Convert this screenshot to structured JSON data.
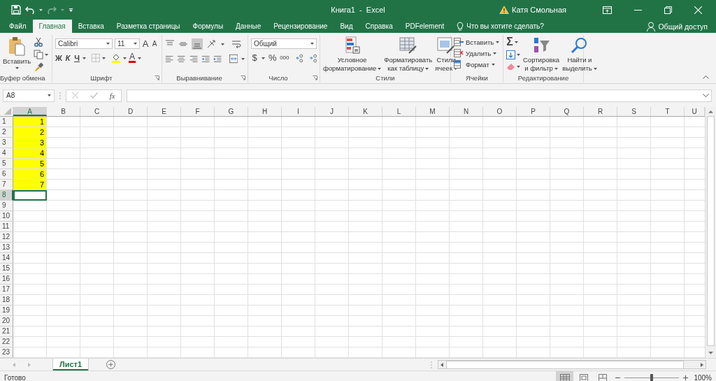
{
  "title_bar": {
    "title": "Книга1  -  Excel",
    "user": "Катя Смольная"
  },
  "tabs": [
    {
      "label": "Файл",
      "selected": false
    },
    {
      "label": "Главная",
      "selected": true
    },
    {
      "label": "Вставка",
      "selected": false
    },
    {
      "label": "Разметка страницы",
      "selected": false
    },
    {
      "label": "Формулы",
      "selected": false
    },
    {
      "label": "Данные",
      "selected": false
    },
    {
      "label": "Рецензирование",
      "selected": false
    },
    {
      "label": "Вид",
      "selected": false
    },
    {
      "label": "Справка",
      "selected": false
    },
    {
      "label": "PDFelement",
      "selected": false
    }
  ],
  "tell_me": {
    "label": "Что вы хотите сделать?"
  },
  "share": {
    "label": "Общий доступ"
  },
  "ribbon": {
    "clipboard": {
      "label": "Буфер обмена",
      "paste": "Вставить"
    },
    "font": {
      "label": "Шрифт",
      "font_name": "Calibri",
      "font_size": "11",
      "grow": "A",
      "shrink": "A",
      "bold": "Ж",
      "italic": "К",
      "underline": "Ч",
      "font_color": "A"
    },
    "alignment": {
      "label": "Выравнивание"
    },
    "number": {
      "label": "Число",
      "format": "Общий",
      "currency": "$",
      "percent": "%",
      "thousands": "000"
    },
    "styles": {
      "label": "Стили",
      "buttons": [
        {
          "lines": [
            "Условное",
            "форматирование"
          ]
        },
        {
          "lines": [
            "Форматировать",
            "как таблицу"
          ]
        },
        {
          "lines": [
            "Стили",
            "ячеек"
          ]
        }
      ]
    },
    "cells": {
      "label": "Ячейки",
      "buttons": [
        "Вставить",
        "Удалить",
        "Формат"
      ]
    },
    "editing": {
      "label": "Редактирование",
      "autosum": "Σ",
      "buttons": [
        {
          "lines": [
            "Сортировка",
            "и фильтр"
          ]
        },
        {
          "lines": [
            "Найти и",
            "выделить"
          ]
        }
      ]
    }
  },
  "formula_bar": {
    "name_box": "A8",
    "function_label": "fx"
  },
  "grid": {
    "columns": [
      {
        "label": "A",
        "selected": true
      },
      {
        "label": "B",
        "selected": false
      },
      {
        "label": "C",
        "selected": false
      },
      {
        "label": "D",
        "selected": false
      },
      {
        "label": "E",
        "selected": false
      },
      {
        "label": "F",
        "selected": false
      },
      {
        "label": "G",
        "selected": false
      },
      {
        "label": "H",
        "selected": false
      },
      {
        "label": "I",
        "selected": false
      },
      {
        "label": "J",
        "selected": false
      },
      {
        "label": "K",
        "selected": false
      },
      {
        "label": "L",
        "selected": false
      },
      {
        "label": "M",
        "selected": false
      },
      {
        "label": "N",
        "selected": false
      },
      {
        "label": "O",
        "selected": false
      },
      {
        "label": "P",
        "selected": false
      },
      {
        "label": "Q",
        "selected": false
      },
      {
        "label": "R",
        "selected": false
      },
      {
        "label": "S",
        "selected": false
      },
      {
        "label": "T",
        "selected": false
      },
      {
        "label": "U",
        "selected": false
      }
    ],
    "rows": [
      {
        "label": "1",
        "selected": false,
        "cells": [
          {
            "value": "1",
            "color": "#ffff00",
            "selected": false
          }
        ]
      },
      {
        "label": "2",
        "selected": false,
        "cells": [
          {
            "value": "2",
            "color": "#ffff00",
            "selected": false
          }
        ]
      },
      {
        "label": "3",
        "selected": false,
        "cells": [
          {
            "value": "3",
            "color": "#ffff00",
            "selected": false
          }
        ]
      },
      {
        "label": "4",
        "selected": false,
        "cells": [
          {
            "value": "4",
            "color": "#ffff00",
            "selected": false
          }
        ]
      },
      {
        "label": "5",
        "selected": false,
        "cells": [
          {
            "value": "5",
            "color": "#ffff00",
            "selected": false
          }
        ]
      },
      {
        "label": "6",
        "selected": false,
        "cells": [
          {
            "value": "6",
            "color": "#ffff00",
            "selected": false
          }
        ]
      },
      {
        "label": "7",
        "selected": false,
        "cells": [
          {
            "value": "7",
            "color": "#ffff00",
            "selected": false
          }
        ]
      },
      {
        "label": "8",
        "selected": true,
        "cells": [
          {
            "selected": true
          }
        ]
      },
      {
        "label": "9",
        "selected": false
      },
      {
        "label": "10",
        "selected": false
      },
      {
        "label": "11",
        "selected": false
      },
      {
        "label": "12",
        "selected": false
      },
      {
        "label": "13",
        "selected": false
      },
      {
        "label": "14",
        "selected": false
      },
      {
        "label": "15",
        "selected": false
      },
      {
        "label": "16",
        "selected": false
      },
      {
        "label": "17",
        "selected": false
      },
      {
        "label": "18",
        "selected": false
      },
      {
        "label": "19",
        "selected": false
      },
      {
        "label": "20",
        "selected": false
      },
      {
        "label": "21",
        "selected": false
      },
      {
        "label": "22",
        "selected": false
      },
      {
        "label": "23",
        "selected": false
      }
    ]
  },
  "sheet_tabs": [
    {
      "label": "Лист1",
      "selected": true
    }
  ],
  "status_bar": {
    "status": "Готово",
    "views": [
      {
        "kind": "normal",
        "selected": true
      },
      {
        "kind": "page_layout",
        "selected": false
      },
      {
        "kind": "page_break",
        "selected": false
      }
    ],
    "zoom": {
      "level": 0.5,
      "reading": "100%"
    }
  }
}
